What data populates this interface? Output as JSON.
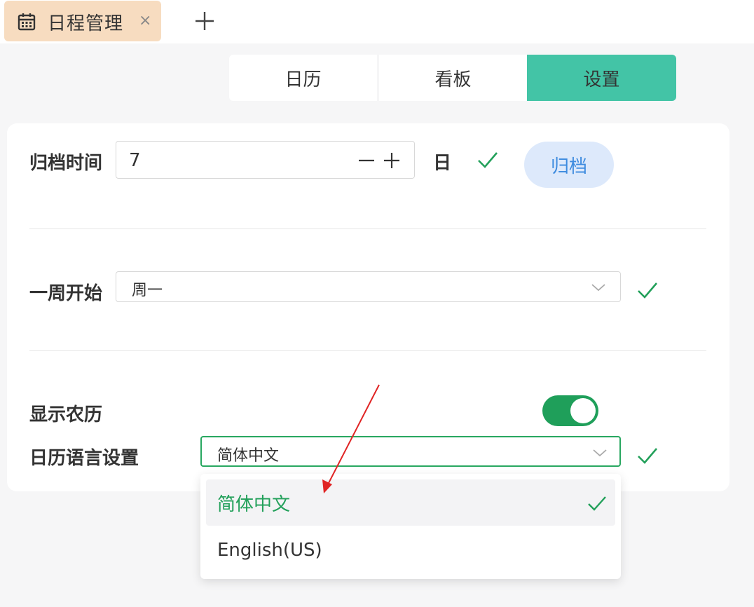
{
  "tab": {
    "title": "日程管理",
    "close": "×"
  },
  "views": {
    "calendar": "日历",
    "board": "看板",
    "settings": "设置"
  },
  "archive": {
    "label": "归档时间",
    "value": "7",
    "unit": "日",
    "button": "归档"
  },
  "week_start": {
    "label": "一周开始",
    "value": "周一"
  },
  "lunar": {
    "label": "显示农历",
    "enabled": true
  },
  "language": {
    "label": "日历语言设置",
    "value": "简体中文",
    "options": [
      "简体中文",
      "English(US)"
    ]
  },
  "colors": {
    "accent": "#43c4a6",
    "check": "#22a05a",
    "toggle": "#1f9f5a",
    "button_bg": "#dde9fb",
    "button_text": "#3d8bdf",
    "tab_bg": "#f7dcc0",
    "annotation_arrow": "#e02424"
  },
  "icons": {
    "tab": "calendar-icon",
    "add": "plus-icon",
    "confirm": "check-icon",
    "dropdown": "chevron-down-icon"
  }
}
